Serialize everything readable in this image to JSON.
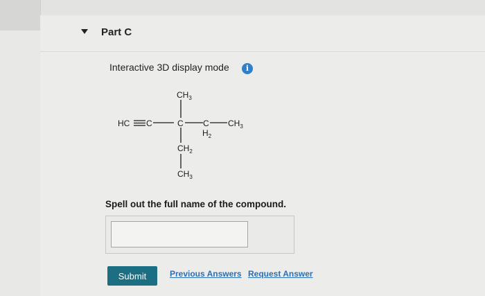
{
  "part": {
    "title": "Part C"
  },
  "display_mode": {
    "label": "Interactive 3D display mode",
    "info_icon": "info-icon",
    "info_glyph": "i"
  },
  "molecule": {
    "groups": {
      "left_alkyne": "HC",
      "left_carbon": "C",
      "center_carbon": "C",
      "top_methyl": "CH3",
      "right_ch2": "C",
      "right_ch2_h": "H2",
      "right_methyl": "CH3",
      "bottom_ch2": "CH2",
      "bottom_methyl": "CH3"
    }
  },
  "question": {
    "text": "Spell out the full name of the compound."
  },
  "answer": {
    "value": "",
    "placeholder": ""
  },
  "actions": {
    "submit_label": "Submit",
    "previous_answers_label": "Previous Answers",
    "request_answer_label": "Request Answer"
  },
  "colors": {
    "accent": "#1c6e82",
    "link": "#2b6fb6",
    "info": "#2f7fc9"
  }
}
